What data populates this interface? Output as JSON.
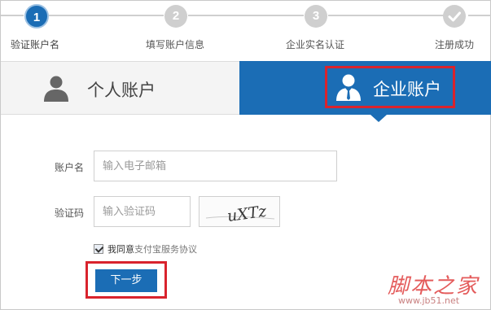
{
  "steps": [
    {
      "number": "1",
      "label": "验证账户名",
      "state": "active"
    },
    {
      "number": "2",
      "label": "填写账户信息",
      "state": "pending"
    },
    {
      "number": "3",
      "label": "企业实名认证",
      "state": "pending"
    },
    {
      "number": "",
      "label": "注册成功",
      "state": "pending",
      "icon": "check-icon"
    }
  ],
  "tabs": {
    "personal": {
      "label": "个人账户",
      "icon": "person-icon",
      "selected": false
    },
    "business": {
      "label": "企业账户",
      "icon": "business-person-icon",
      "selected": true
    }
  },
  "form": {
    "account_label": "账户名",
    "account_placeholder": "输入电子邮箱",
    "captcha_label": "验证码",
    "captcha_placeholder": "输入验证码",
    "captcha_text": "uXTz",
    "agree_checked": true,
    "agree_text": "我同意",
    "agree_link": "支付宝服务协议",
    "next_label": "下一步"
  },
  "watermark": {
    "title": "脚本之家",
    "url": "www.jb51.net"
  },
  "colors": {
    "accent": "#1b6db5",
    "highlight": "#d9232d",
    "inactive": "#cfcfcf"
  }
}
